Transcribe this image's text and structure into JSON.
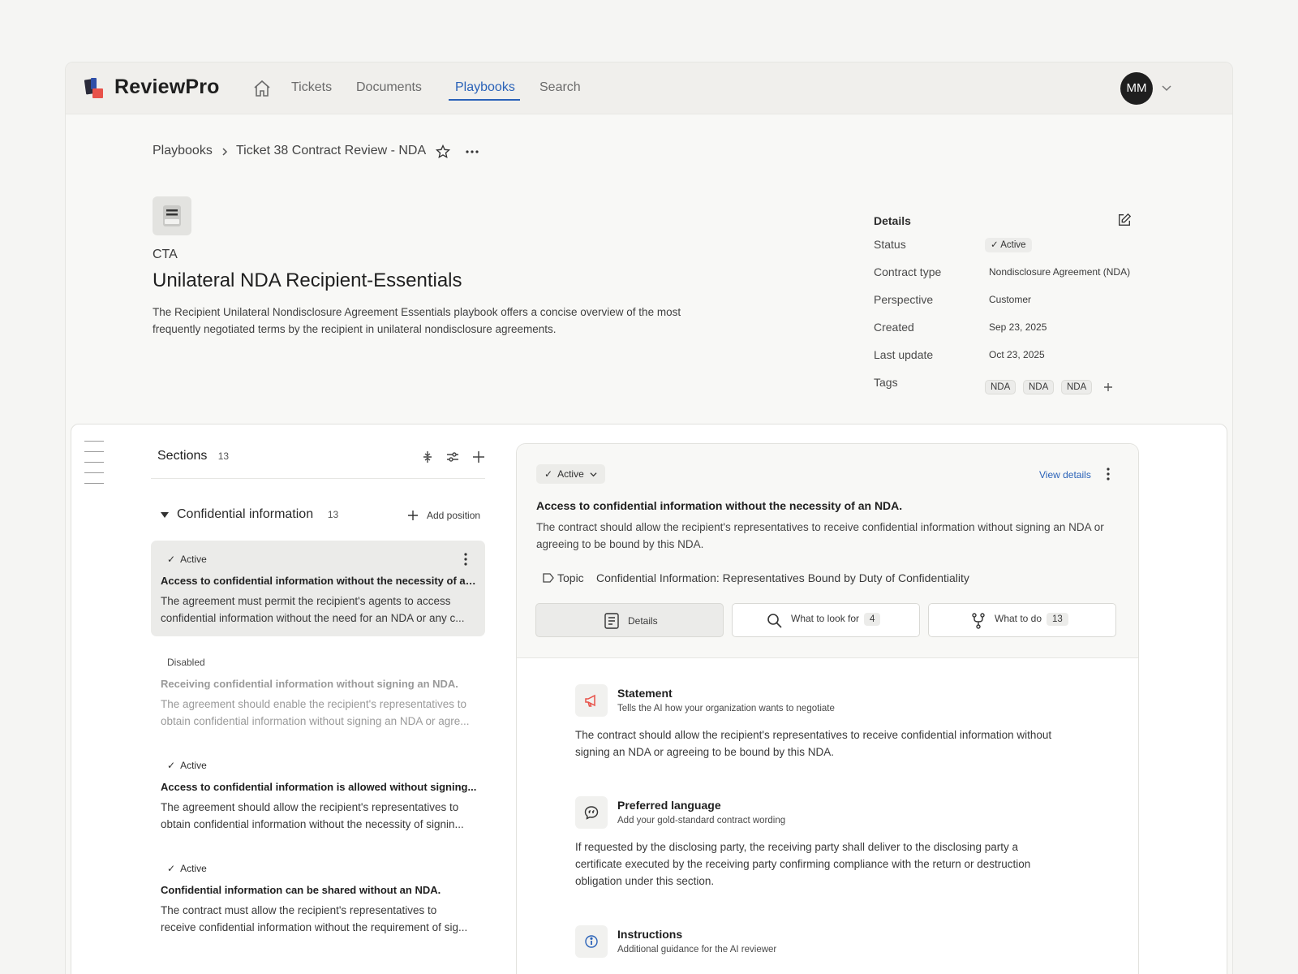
{
  "app": {
    "brand": "ReviewPro"
  },
  "nav": {
    "items": [
      "Tickets",
      "Documents",
      "Playbooks",
      "Search"
    ],
    "active": "Playbooks"
  },
  "user": {
    "initials": "MM"
  },
  "breadcrumb": {
    "root": "Playbooks",
    "current": "Ticket 38 Contract Review - NDA"
  },
  "playbook": {
    "kicker": "CTA",
    "title": "Unilateral NDA Recipient-Essentials",
    "description": "The Recipient Unilateral Nondisclosure Agreement Essentials playbook offers a concise overview of the most frequently negotiated terms by the recipient in unilateral nondisclosure agreements."
  },
  "details": {
    "heading": "Details",
    "rows": [
      {
        "label": "Status",
        "value": "Active"
      },
      {
        "label": "Contract type",
        "value": "Nondisclosure Agreement (NDA)"
      },
      {
        "label": "Perspective",
        "value": "Customer"
      },
      {
        "label": "Created",
        "value": "Sep 23, 2025"
      },
      {
        "label": "Last update",
        "value": "Oct 23, 2025"
      },
      {
        "label": "Tags",
        "value": ""
      }
    ],
    "tags": [
      "NDA",
      "NDA",
      "NDA"
    ]
  },
  "sections": {
    "title": "Sections",
    "count": "13",
    "group": {
      "title": "Confidential information",
      "count": "13",
      "add_label": "Add position"
    },
    "cards": [
      {
        "status": "Active",
        "title": "Access to confidential information without the necessity of an...",
        "body1": "The agreement must permit the recipient's agents to access",
        "body2": "confidential information without the need for an NDA or any c..."
      },
      {
        "status": "Disabled",
        "title": "Receiving confidential information without signing an NDA.",
        "body1": "The agreement should enable the recipient's representatives to",
        "body2": "obtain confidential information without signing an NDA or agre..."
      },
      {
        "status": "Active",
        "title": "Access to confidential information is allowed without signing...",
        "body1": "The agreement should allow the recipient's representatives to",
        "body2": "obtain confidential information without the necessity of signin..."
      },
      {
        "status": "Active",
        "title": "Confidential information can be shared without an NDA.",
        "body1": "The contract must allow the recipient's representatives to",
        "body2": "receive confidential information without the requirement of sig..."
      }
    ]
  },
  "position": {
    "status": "Active",
    "view_details": "View details",
    "title": "Access to confidential information without the necessity of an NDA.",
    "body": "The contract should allow the recipient's representatives to receive confidential information without signing an NDA or agreeing to be bound by this NDA.",
    "topic_label": "Topic",
    "topic_value": "Confidential Information: Representatives Bound by Duty of Confidentiality",
    "tabs": [
      {
        "label": "Details",
        "badge": ""
      },
      {
        "label": "What to look for",
        "badge": "4"
      },
      {
        "label": "What to do",
        "badge": "13"
      }
    ]
  },
  "blocks": [
    {
      "title": "Statement",
      "subtitle": "Tells the AI how your organization wants to negotiate",
      "text": "The contract should allow the recipient's representatives to receive confidential information without signing an NDA or agreeing to be bound by this NDA.",
      "icon": "megaphone-icon"
    },
    {
      "title": "Preferred language",
      "subtitle": "Add your gold-standard contract wording",
      "text": "If requested by the disclosing party, the receiving party shall deliver to the disclosing party a certificate executed by the receiving party confirming compliance with the return or destruction obligation under this section.",
      "icon": "quote-icon"
    },
    {
      "title": "Instructions",
      "subtitle": "Additional guidance for the AI reviewer",
      "text": "",
      "icon": "info-icon"
    }
  ],
  "colors": {
    "accent": "#2a62b8",
    "logo_red": "#e8524a",
    "logo_blue": "#2f4fa8",
    "logo_dark": "#2b2b3a"
  }
}
